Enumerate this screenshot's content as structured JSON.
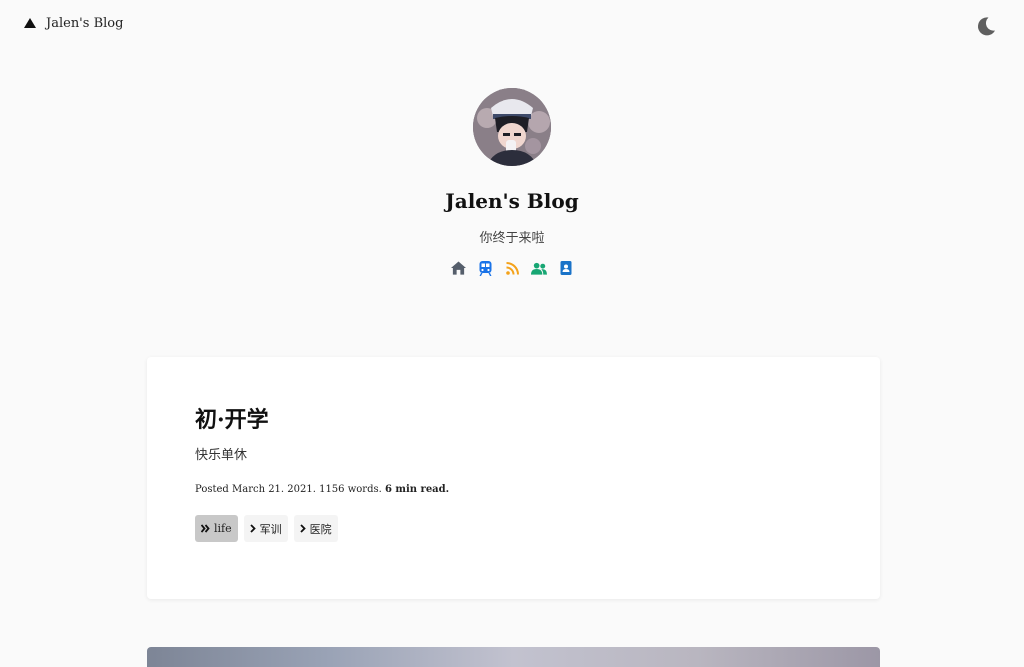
{
  "header": {
    "brand_label": "Jalen's Blog",
    "theme_toggle_icon": "moon-icon"
  },
  "hero": {
    "title": "Jalen's Blog",
    "subtitle": "你终于来啦",
    "social": [
      {
        "icon": "home-icon",
        "color": "#555e6b"
      },
      {
        "icon": "subway-icon",
        "color": "#1a73e8"
      },
      {
        "icon": "rss-icon",
        "color": "#f4a21a"
      },
      {
        "icon": "users-icon",
        "color": "#17a673"
      },
      {
        "icon": "contact-card-icon",
        "color": "#1a73c8"
      }
    ]
  },
  "post": {
    "title": "初·开学",
    "excerpt": "快乐单休",
    "meta": {
      "posted": "Posted March 21. 2021. 1156 words.",
      "read_time": "6 min read."
    },
    "tags": [
      {
        "label": "life",
        "icon": "double-chevron-right-icon",
        "active": true
      },
      {
        "label": "军训",
        "icon": "chevron-right-icon",
        "active": false
      },
      {
        "label": "医院",
        "icon": "chevron-right-icon",
        "active": false
      }
    ]
  }
}
